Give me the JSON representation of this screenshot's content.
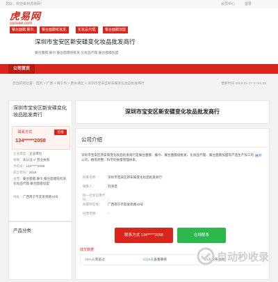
{
  "topbar": {
    "welcome": "您好，欢迎来到虎易网！",
    "links": [
      "会员中心",
      "登录"
    ]
  },
  "header": {
    "logo_main": "虎易网",
    "logo_sub": "coovee.com",
    "logo_tags": [
      "餐台面膜,餐巾,",
      "餐台面膜纸批发,",
      "化妆品代理,",
      "餐台面膜加盟"
    ],
    "company_name": "深圳市宝安区新安碟变化妆品批发商行",
    "subline1": "餐台面膜,餐巾,餐台面膜纸批发,化妆品代理,餐台面膜加盟",
    "subline2": ""
  },
  "nav": {
    "home_label": "公司首页"
  },
  "breadcrumb": "您当前的位置：首页 > 广西 > 南宁市 > 西乡塘区 > 深圳市宝安区新安碟变化妆品批发商行",
  "update_time": "更新时间 2023-01-17 17:01:23",
  "sidebar": {
    "company_name": "深圳市宝安区新安碟变化妆品批发商行",
    "phone_label": "联系方式",
    "phone_btn": "在线",
    "phone_number": "134*****2058",
    "info": [
      {
        "k": "企业类型：",
        "v": "企业单位"
      },
      {
        "k": "保障：",
        "v": "未认证  ✔ 营业执照"
      },
      {
        "k": "手机号：",
        "v": "134*****2058"
      },
      {
        "k": "成立年份：",
        "v": "2018"
      },
      {
        "k": "主营：",
        "v": "餐台面膜,餐巾,餐台面膜纸批发,化妆品代理,餐台面膜加盟"
      },
      {
        "k": "地址：",
        "v": "广西南宁市友爱南路33号"
      }
    ],
    "category_title": "产品分类"
  },
  "main": {
    "title": "深圳市宝安区新安碟变化妆品批发商行",
    "intro_title": "公司介绍",
    "intro_text": "深圳市宝安区新安碟变化妆品批发商行是餐台面膜、餐巾、餐台面膜纸批发、化妆品代理、餐台面膜加盟等产品生产加工的公司，拥有完整、科学的质量管理体系。",
    "expand": "展开",
    "fields": [
      {
        "k": "商家名称：",
        "v": "深圳市宝安区新安碟变化妆品批发商行"
      },
      {
        "k": "联系人：",
        "v": "刘泽佳"
      },
      {
        "k": "统一社会信用代码：",
        "v": "-"
      },
      {
        "k": "商家所在地：",
        "v": "广西南宁市友爱南路33号"
      },
      {
        "k": "经营范围：",
        "v": "-"
      }
    ],
    "contact_btn": "联系方式  134*****2058",
    "online_btn": "在线联系",
    "record_label": "成交数据",
    "metrics": [
      {
        "v": "26%",
        "k": "人浏览过"
      },
      {
        "v": "2113",
        "k": "人查看联系"
      },
      {
        "v": "14",
        "k": "人发布询盘"
      }
    ]
  },
  "watermark": {
    "text": "自动秒收录"
  },
  "colors": {
    "brand": "#d9261c",
    "green": "#2db84d"
  }
}
